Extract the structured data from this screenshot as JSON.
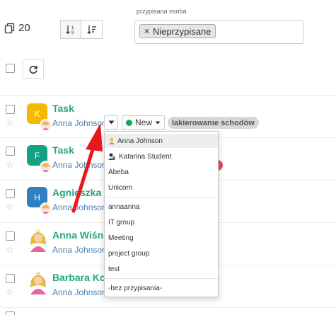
{
  "toolbar": {
    "count": "20",
    "count_icon": "copy-icon",
    "sort_icons": [
      "sort-numeric-icon",
      "sort-filter-icon"
    ],
    "refresh_icon": "refresh-icon"
  },
  "filter": {
    "label": "przypisana osoba",
    "tag": "Nieprzypisane",
    "tag_remove": "×"
  },
  "rows": [
    {
      "avatar_letter": "K",
      "avatar_color": "#f5b800",
      "title": "Task",
      "assignee": "Anna Johnson"
    },
    {
      "avatar_letter": "F",
      "avatar_color": "#14a085",
      "title": "Task",
      "assignee": "Anna Johnson"
    },
    {
      "avatar_letter": "H",
      "avatar_color": "#2f7fc1",
      "title": "Agnieszka",
      "assignee": "Anna Johnson"
    },
    {
      "avatar_letter": "",
      "avatar_color": "",
      "title": "Anna Wiśn",
      "assignee": "Anna Johnson"
    },
    {
      "avatar_letter": "",
      "avatar_color": "",
      "title": "Barbara Ko",
      "assignee": "Anna Johnson"
    }
  ],
  "status": {
    "label": "New",
    "color": "#1fa35a"
  },
  "tag_label": "lakierowanie schodów",
  "dropdown": {
    "items": [
      "Anna Johnson",
      "Katarina Student",
      "Abeba",
      "Unicorn",
      "annaanna",
      "IT group",
      "Meeting",
      "project group",
      "test",
      "-bez przypisania-"
    ]
  },
  "colors": {
    "title_green": "#27a67e",
    "link_blue": "#4a7fb5",
    "arrow_red": "#e8181e"
  }
}
